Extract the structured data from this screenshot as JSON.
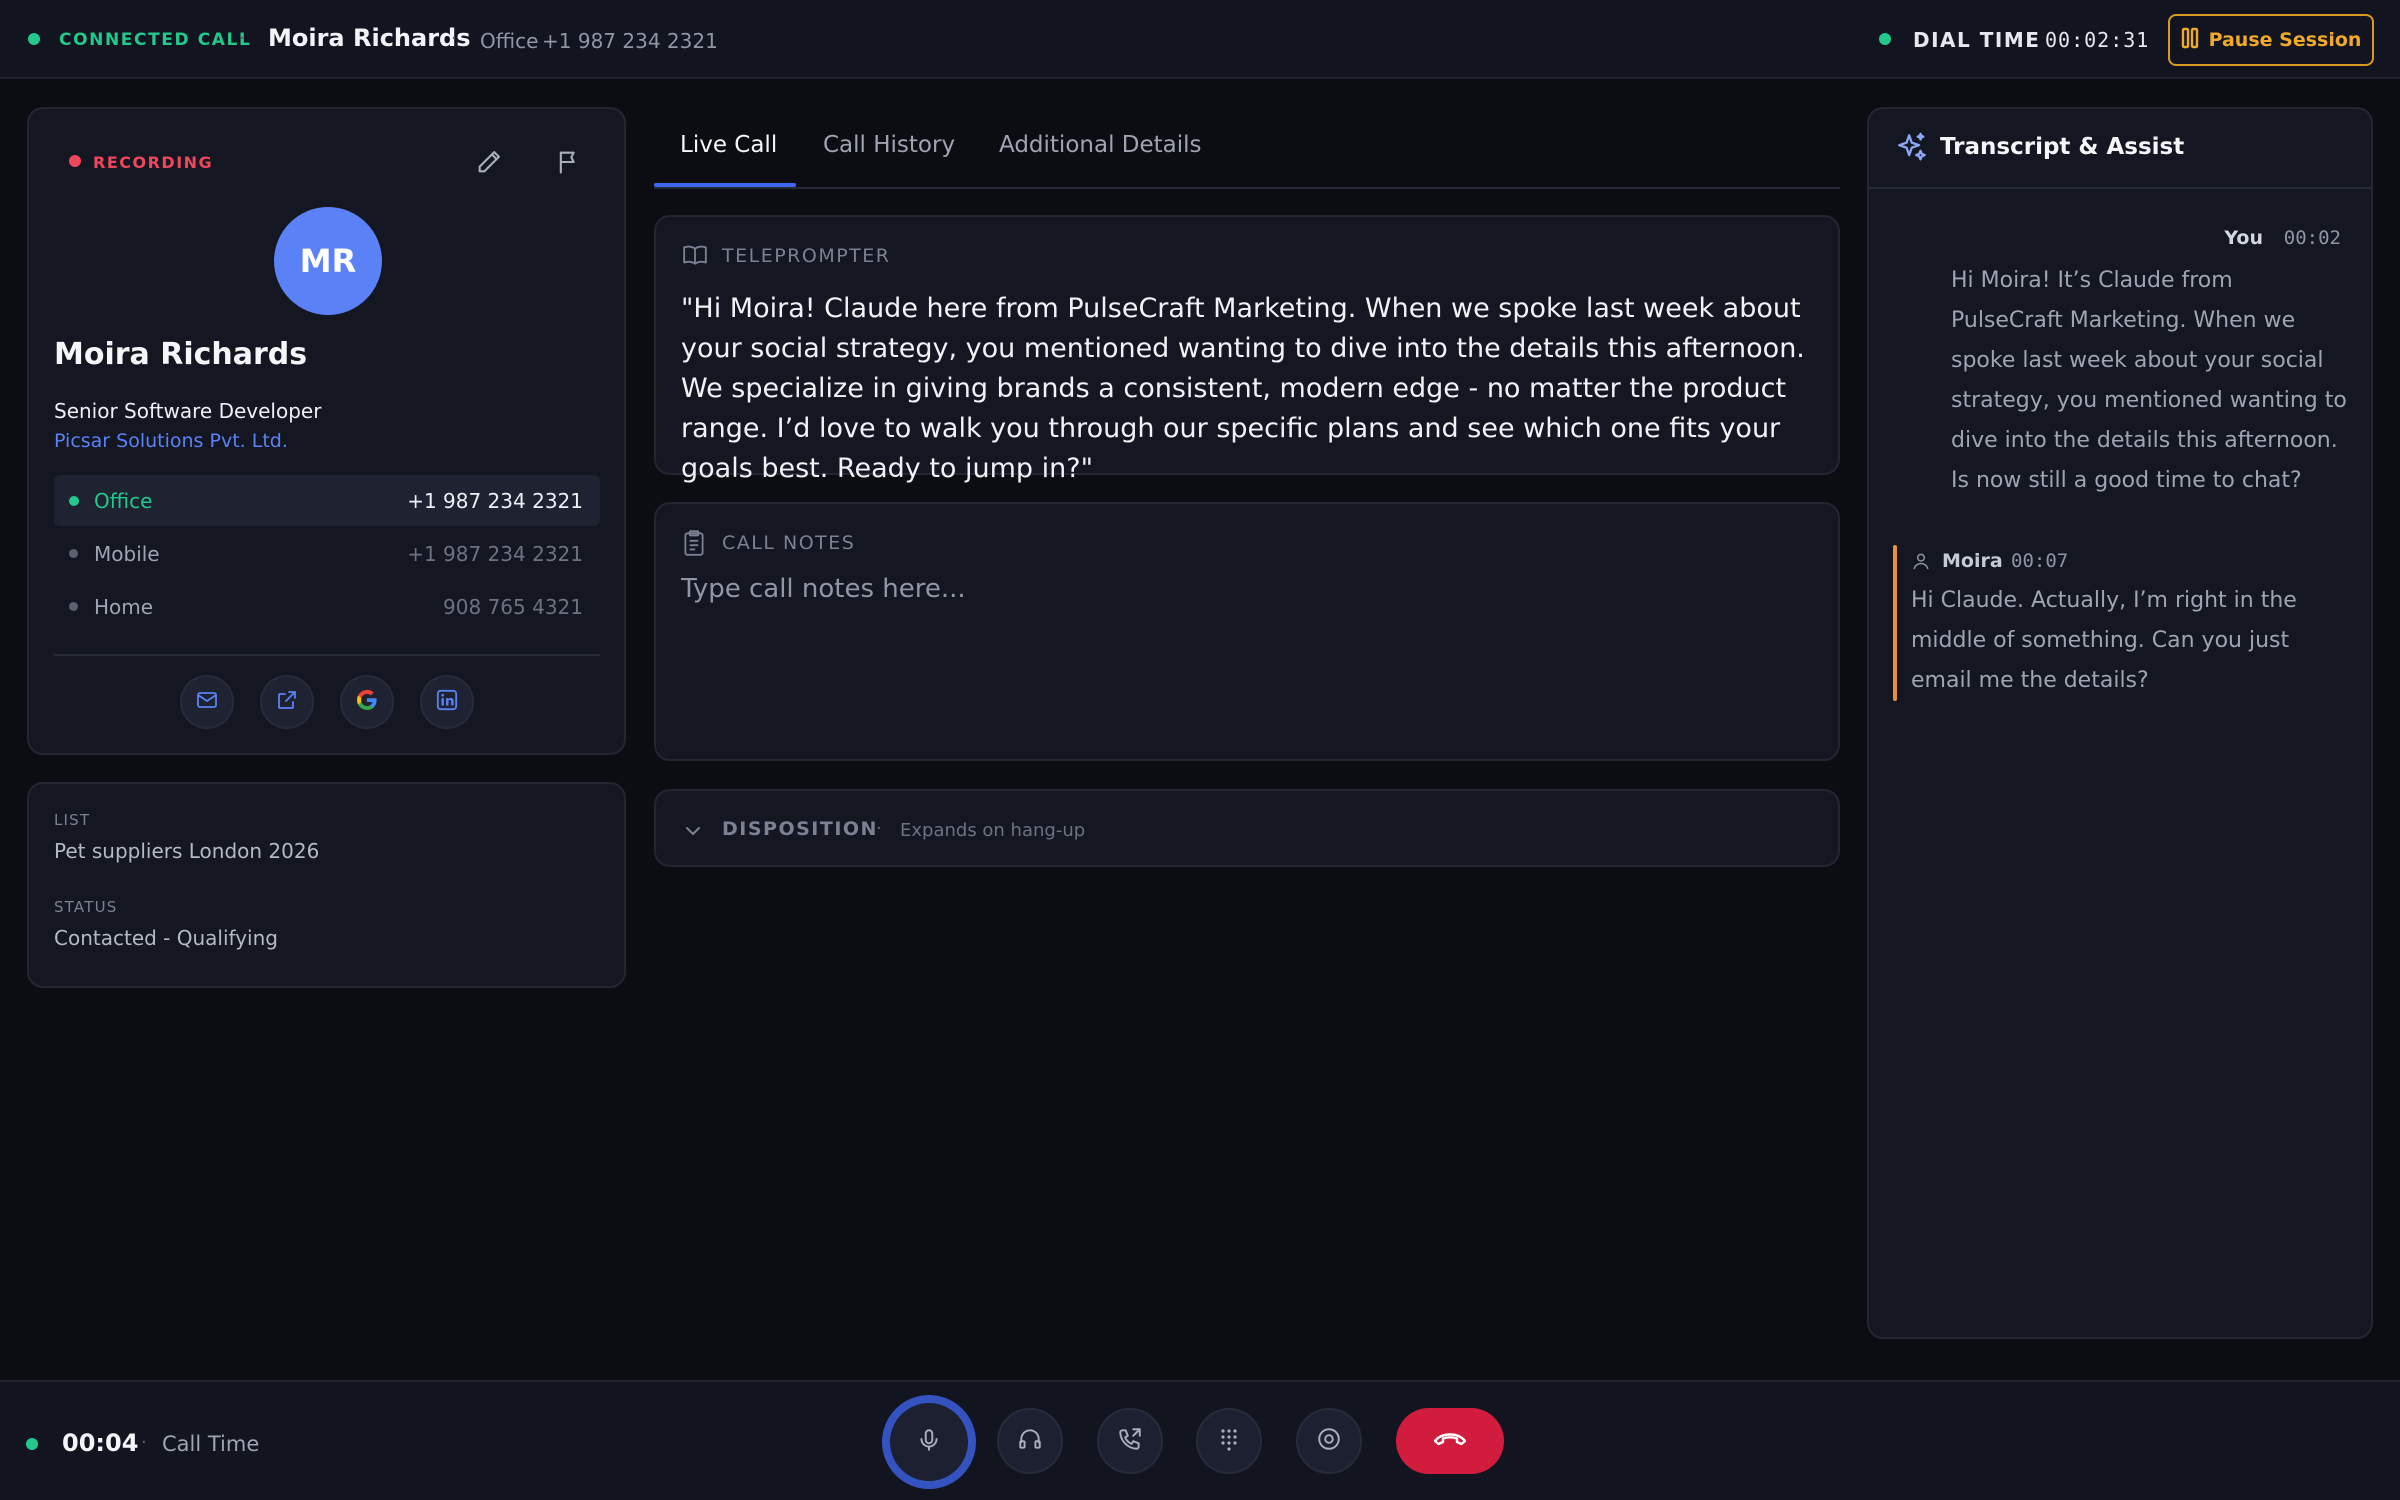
{
  "header": {
    "status": "CONNECTED CALL",
    "separator": "·",
    "contact_name": "Moira Richards",
    "line_label": "Office",
    "line_number": "+1 987 234 2321",
    "dial_time_label": "DIAL TIME",
    "dial_time_value": "00:02:31",
    "pause_label": "Pause Session"
  },
  "contact": {
    "recording_label": "RECORDING",
    "initials": "MR",
    "name": "Moira Richards",
    "title": "Senior Software Developer",
    "company": "Picsar Solutions Pvt. Ltd.",
    "phones": [
      {
        "label": "Office",
        "number": "+1 987 234 2321",
        "active": true
      },
      {
        "label": "Mobile",
        "number": "+1 987 234 2321",
        "active": false
      },
      {
        "label": "Home",
        "number": "908 765 4321",
        "active": false
      }
    ],
    "social_icons": [
      "mail-icon",
      "external-link-icon",
      "google-icon",
      "linkedin-icon"
    ]
  },
  "list_info": {
    "list_label": "LIST",
    "list_value": "Pet suppliers London 2026",
    "status_label": "STATUS",
    "status_value": "Contacted - Qualifying"
  },
  "tabs": [
    {
      "label": "Live Call",
      "active": true
    },
    {
      "label": "Call History",
      "active": false
    },
    {
      "label": "Additional Details",
      "active": false
    }
  ],
  "teleprompter": {
    "label": "TELEPROMPTER",
    "text": "\"Hi Moira! Claude here from PulseCraft Marketing. When we spoke last week about your social strategy, you mentioned wanting to dive into the details this afternoon. We specialize in giving brands a consistent, modern edge - no matter the product range. I’d love to walk you through our specific plans and see which one fits your goals best. Ready to jump in?\""
  },
  "notes": {
    "label": "CALL NOTES",
    "value": "",
    "placeholder": "Type call notes here..."
  },
  "disposition": {
    "label": "DISPOSITION",
    "separator": "·",
    "hint": "Expands on hang-up"
  },
  "transcript": {
    "title": "Transcript & Assist",
    "messages": [
      {
        "speaker": "You",
        "time": "00:02",
        "text": "Hi Moira! It’s Claude from PulseCraft Marketing. When we spoke last week about your social strategy, you mentioned wanting to dive into the details this afternoon. Is now still a good time to chat?"
      },
      {
        "speaker": "Moira",
        "time": "00:07",
        "text": "Hi Claude. Actually, I’m right in the middle of something. Can you just email me the details?"
      }
    ]
  },
  "footer": {
    "call_time": "00:04",
    "separator": "·",
    "call_time_label": "Call Time",
    "controls": [
      "microphone-icon",
      "headset-icon",
      "call-transfer-icon",
      "keypad-icon",
      "record-icon",
      "hang-up-icon"
    ]
  },
  "colors": {
    "background": "#0c0d12",
    "panel": "#141722",
    "accent_blue": "#3d67f0",
    "connected_green": "#22c98a",
    "recording_red": "#f0465c",
    "pause_amber": "#f0a928",
    "hangup_red": "#d11c3e"
  }
}
